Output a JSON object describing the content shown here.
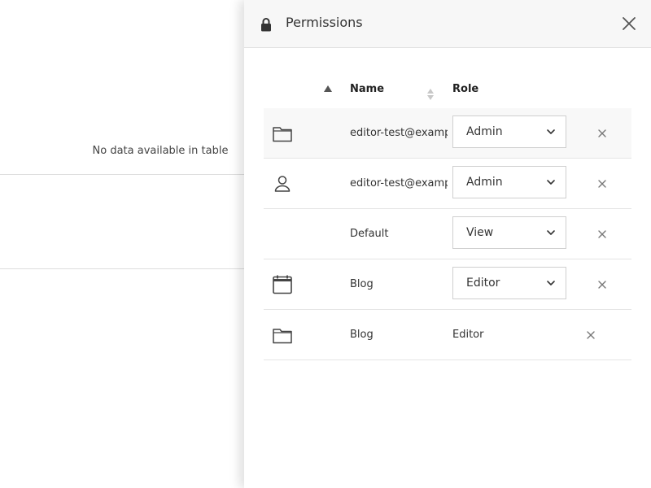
{
  "background": {
    "empty_message": "No data available in table"
  },
  "panel": {
    "title": "Permissions",
    "icons": {
      "header": "lock-icon",
      "close": "close-icon"
    }
  },
  "table": {
    "headers": {
      "name": "Name",
      "role": "Role"
    },
    "rows": [
      {
        "icon": "folder-icon",
        "name": "editor-test@exampl",
        "role": "Admin",
        "editable": true
      },
      {
        "icon": "user-icon",
        "name": "editor-test@exampl",
        "role": "Admin",
        "editable": true
      },
      {
        "icon": "",
        "name": "Default",
        "role": "View",
        "editable": true
      },
      {
        "icon": "calendar-icon",
        "name": "Blog",
        "role": "Editor",
        "editable": true
      },
      {
        "icon": "folder-icon",
        "name": "Blog",
        "role": "Editor",
        "editable": false
      }
    ]
  }
}
